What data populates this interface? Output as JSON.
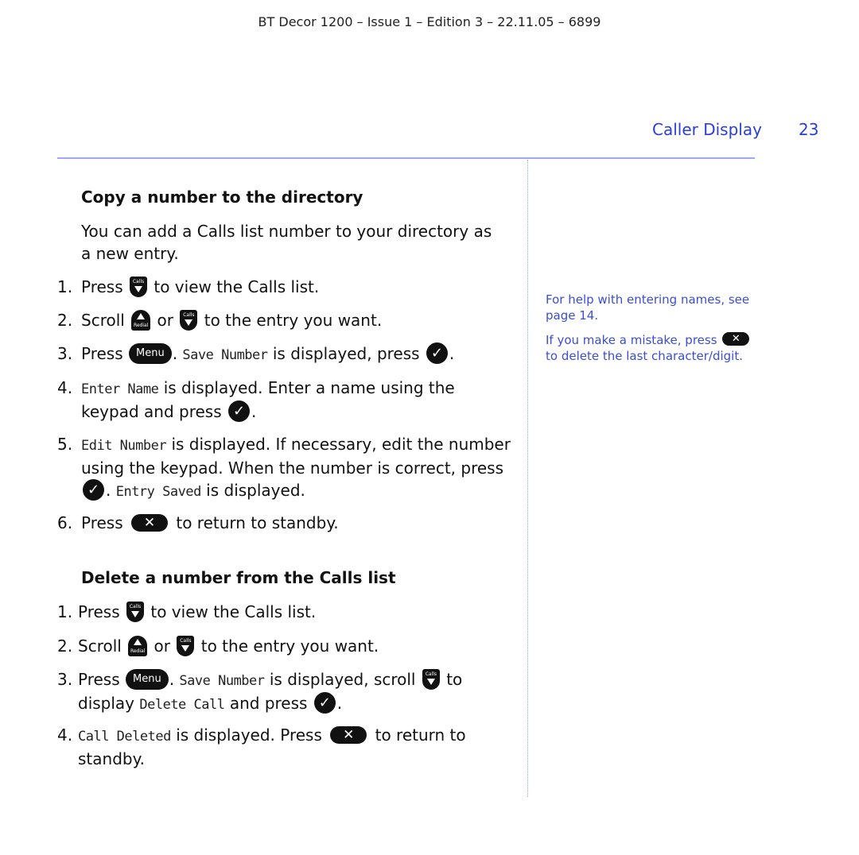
{
  "header": {
    "doc_line": "BT Decor 1200 – Issue 1 – Edition 3 – 22.11.05 – 6899"
  },
  "page": {
    "section": "Caller Display",
    "number": "23",
    "accent_color": "#2a3ed8",
    "rule_color": "#9aa8f5"
  },
  "keys": {
    "calls": "Calls",
    "redial": "Redial",
    "menu": "Menu",
    "ok": "✓",
    "cancel": "✕"
  },
  "copy_section": {
    "title": "Copy a number to the directory",
    "intro": "You can add a Calls list number to your directory as a new entry.",
    "steps": [
      {
        "num": "1.",
        "a": "Press",
        "b": "to view the Calls list."
      },
      {
        "num": "2.",
        "a": "Scroll",
        "or": "or",
        "b": "to the entry you want."
      },
      {
        "num": "3.",
        "a": "Press",
        "b": ".",
        "lcd": "Save Number",
        "c": "is displayed, press",
        "d": "."
      },
      {
        "num": "4.",
        "lcd": "Enter Name",
        "a": "is displayed. Enter a name using the keypad and press",
        "b": "."
      },
      {
        "num": "5.",
        "lcd": "Edit Number",
        "a": "is displayed. If necessary, edit the number using the keypad. When the number is correct, press",
        "b": ".",
        "lcd2": "Entry Saved",
        "c": "is displayed."
      },
      {
        "num": "6.",
        "a": "Press",
        "b": "to return to standby."
      }
    ]
  },
  "delete_section": {
    "title": "Delete a number from the Calls list",
    "steps": [
      {
        "num": "1.",
        "a": "Press",
        "b": "to view the Calls list."
      },
      {
        "num": "2.",
        "a": "Scroll",
        "or": "or",
        "b": "to the entry you want."
      },
      {
        "num": "3.",
        "a": "Press",
        "b": ".",
        "lcd": "Save Number",
        "c": "is displayed, scroll",
        "d": "to display",
        "lcd2": "Delete Call",
        "e": "and press",
        "f": "."
      },
      {
        "num": "4.",
        "lcd": "Call Deleted",
        "a": "is displayed. Press",
        "b": "to return to standby."
      }
    ]
  },
  "sidebar_notes": [
    {
      "text": "For help with entering names, see page 14."
    },
    {
      "a": "If you make a mistake, press",
      "b": "to delete the last character/digit."
    }
  ]
}
